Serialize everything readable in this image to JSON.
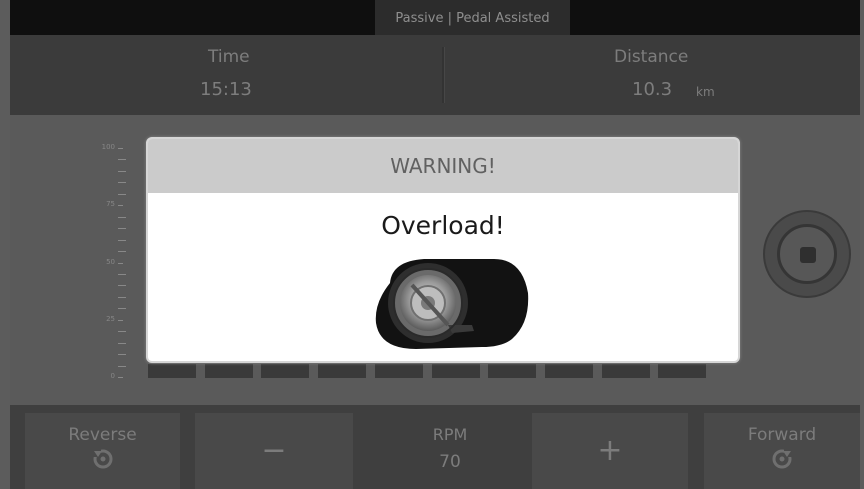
{
  "mode": {
    "label": "Passive | Pedal Assisted"
  },
  "stats": {
    "time": {
      "label": "Time",
      "value": "15:13"
    },
    "distance": {
      "label": "Distance",
      "value": "10.3",
      "unit": "km"
    }
  },
  "scale": {
    "labels": [
      "100",
      "75",
      "50",
      "25",
      "0"
    ]
  },
  "level_segments": 10,
  "controls": {
    "reverse": {
      "label": "Reverse",
      "icon": "rotate-ccw-icon"
    },
    "decrease": {
      "label": "−"
    },
    "rpm": {
      "label": "RPM",
      "value": "70"
    },
    "increase": {
      "label": "+"
    },
    "forward": {
      "label": "Forward",
      "icon": "rotate-cw-icon"
    },
    "stop": {
      "icon": "stop-icon"
    }
  },
  "dialog": {
    "title": "WARNING!",
    "message": "Overload!",
    "icon": "overload-motor-icon"
  },
  "colors": {
    "dialog_header": "#cbcbcb",
    "dialog_body": "#ffffff",
    "background": "#5c5c5c"
  }
}
